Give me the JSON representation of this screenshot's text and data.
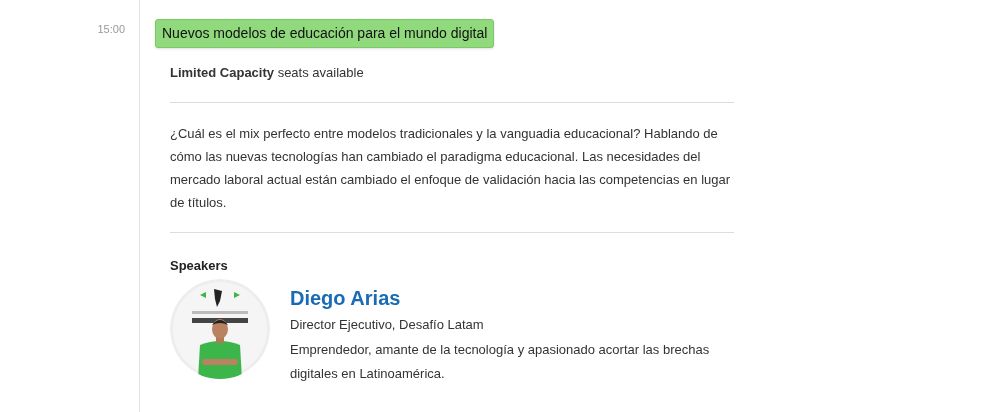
{
  "time": "15:00",
  "session": {
    "title": "Nuevos modelos de educación para el mundo digital",
    "capacity": "**Limited Capacity** seats available",
    "description": "¿Cuál es el mix perfecto entre modelos tradicionales y la vanguadia educacional? Hablando de cómo las nuevas tecnologías han cambiado el paradigma educacional. Las necesidades del mercado laboral actual están cambiado el enfoque de validación hacia las competencias en lugar de títulos."
  },
  "speakers_heading": "Speakers",
  "speakers": [
    {
      "name": "Diego Arias",
      "role": "Director Ejecutivo, Desafío Latam",
      "bio": "Emprendedor, amante de la tecnología y apasionado acortar las brechas digitales en Latinoamérica."
    }
  ]
}
